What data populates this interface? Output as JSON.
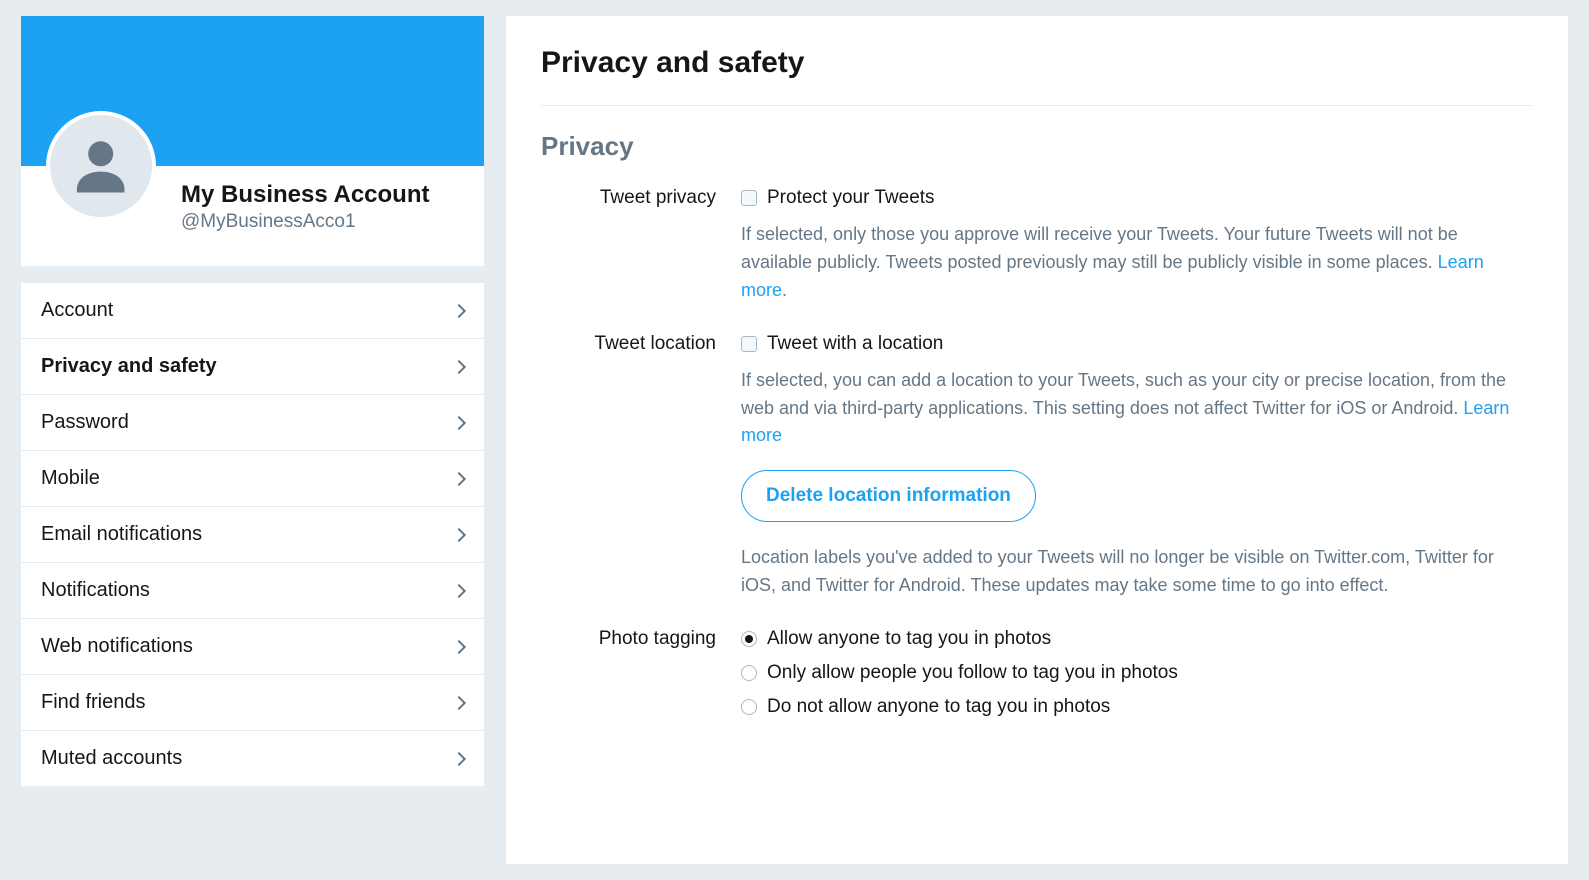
{
  "profile": {
    "display_name": "My Business Account",
    "handle": "@MyBusinessAcco1"
  },
  "sidebar": {
    "items": [
      {
        "label": "Account",
        "key": "account",
        "active": false
      },
      {
        "label": "Privacy and safety",
        "key": "privacy-and-safety",
        "active": true
      },
      {
        "label": "Password",
        "key": "password",
        "active": false
      },
      {
        "label": "Mobile",
        "key": "mobile",
        "active": false
      },
      {
        "label": "Email notifications",
        "key": "email-notifications",
        "active": false
      },
      {
        "label": "Notifications",
        "key": "notifications",
        "active": false
      },
      {
        "label": "Web notifications",
        "key": "web-notifications",
        "active": false
      },
      {
        "label": "Find friends",
        "key": "find-friends",
        "active": false
      },
      {
        "label": "Muted accounts",
        "key": "muted-accounts",
        "active": false
      }
    ]
  },
  "main": {
    "title": "Privacy and safety",
    "section_title": "Privacy",
    "tweet_privacy": {
      "label": "Tweet privacy",
      "checkbox_label": "Protect your Tweets",
      "checked": false,
      "help": "If selected, only those you approve will receive your Tweets. Your future Tweets will not be available publicly. Tweets posted previously may still be publicly visible in some places. ",
      "learn_more": "Learn more",
      "help_suffix": "."
    },
    "tweet_location": {
      "label": "Tweet location",
      "checkbox_label": "Tweet with a location",
      "checked": false,
      "help": "If selected, you can add a location to your Tweets, such as your city or precise location, from the web and via third-party applications. This setting does not affect Twitter for iOS or Android. ",
      "learn_more": "Learn more",
      "button": "Delete location information",
      "help2": "Location labels you've added to your Tweets will no longer be visible on Twitter.com, Twitter for iOS, and Twitter for Android. These updates may take some time to go into effect."
    },
    "photo_tagging": {
      "label": "Photo tagging",
      "options": [
        {
          "label": "Allow anyone to tag you in photos",
          "selected": true
        },
        {
          "label": "Only allow people you follow to tag you in photos",
          "selected": false
        },
        {
          "label": "Do not allow anyone to tag you in photos",
          "selected": false
        }
      ]
    }
  }
}
